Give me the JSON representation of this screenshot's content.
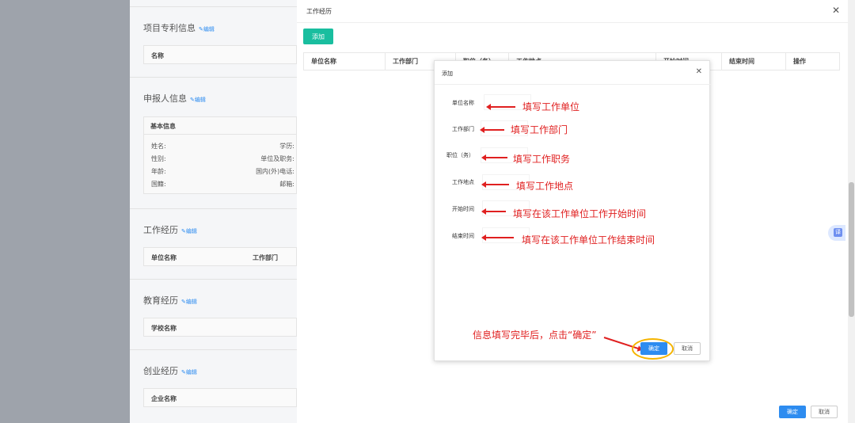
{
  "background": {
    "sections": [
      {
        "title": "项目专利信息",
        "edit": "编辑",
        "cols": [
          "名称"
        ]
      },
      {
        "title": "申报人信息",
        "edit": "编辑"
      },
      {
        "title": "工作经历",
        "edit": "编辑",
        "cols": [
          "单位名称",
          "工作部门"
        ]
      },
      {
        "title": "教育经历",
        "edit": "编辑",
        "cols": [
          "学校名称"
        ]
      },
      {
        "title": "创业经历",
        "edit": "编辑",
        "cols": [
          "企业名称"
        ]
      }
    ],
    "basic_info": {
      "head": "基本信息",
      "left": [
        "姓名:",
        "性别:",
        "年龄:",
        "国籍:"
      ],
      "right": [
        "学历:",
        "单位及职务:",
        "国内(外)电话:",
        "邮箱:"
      ]
    }
  },
  "drawer": {
    "title": "工作经历",
    "add_label": "添加",
    "columns": [
      "单位名称",
      "工作部门",
      "职位（务）",
      "工作地点",
      "开始时间",
      "结束时间",
      "操作"
    ],
    "ok_label": "确定",
    "cancel_label": "取消"
  },
  "modal": {
    "title": "添加",
    "fields": [
      {
        "label": "单位名称",
        "hint": "填写工作单位"
      },
      {
        "label": "工作部门",
        "hint": "填写工作部门"
      },
      {
        "label": "职位（务）",
        "hint": "填写工作职务"
      },
      {
        "label": "工作地点",
        "hint": "填写工作地点"
      },
      {
        "label": "开始时间",
        "hint": "填写在该工作单位工作开始时间"
      },
      {
        "label": "结束时间",
        "hint": "填写在该工作单位工作结束时间"
      }
    ],
    "confirm_hint": "信息填写完毕后，点击“确定”",
    "ok_label": "确定",
    "cancel_label": "取消"
  },
  "float_tool": {
    "label": "译"
  },
  "colors": {
    "primary": "#2d8cf0",
    "add_button": "#19be9f",
    "annotation": "#e02020",
    "highlight": "#f5b400"
  }
}
